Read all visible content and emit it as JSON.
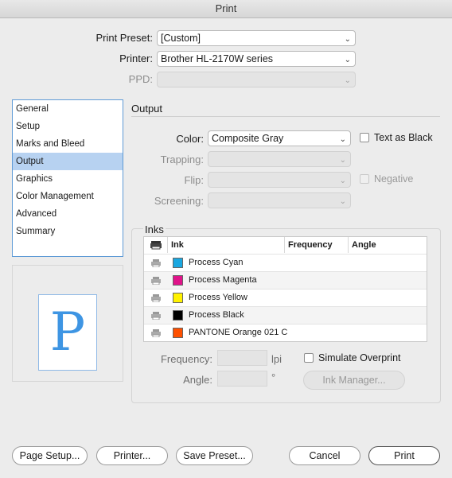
{
  "window": {
    "title": "Print"
  },
  "top": {
    "preset_label": "Print Preset:",
    "preset_value": "[Custom]",
    "printer_label": "Printer:",
    "printer_value": "Brother HL-2170W series",
    "ppd_label": "PPD:",
    "ppd_value": ""
  },
  "sidebar": {
    "items": [
      {
        "label": "General",
        "selected": false
      },
      {
        "label": "Setup",
        "selected": false
      },
      {
        "label": "Marks and Bleed",
        "selected": false
      },
      {
        "label": "Output",
        "selected": true
      },
      {
        "label": "Graphics",
        "selected": false
      },
      {
        "label": "Color Management",
        "selected": false
      },
      {
        "label": "Advanced",
        "selected": false
      },
      {
        "label": "Summary",
        "selected": false
      }
    ]
  },
  "preview": {
    "glyph": "P"
  },
  "output": {
    "section_title": "Output",
    "color_label": "Color:",
    "color_value": "Composite Gray",
    "text_as_black_label": "Text as Black",
    "trapping_label": "Trapping:",
    "trapping_value": "",
    "flip_label": "Flip:",
    "flip_value": "",
    "negative_label": "Negative",
    "screening_label": "Screening:",
    "screening_value": ""
  },
  "inks": {
    "section_title": "Inks",
    "columns": [
      "Ink",
      "Frequency",
      "Angle"
    ],
    "rows": [
      {
        "name": "Process Cyan",
        "color": "#1aa7e0"
      },
      {
        "name": "Process Magenta",
        "color": "#e0138a"
      },
      {
        "name": "Process Yellow",
        "color": "#fff200"
      },
      {
        "name": "Process Black",
        "color": "#000000"
      },
      {
        "name": "PANTONE Orange 021 C",
        "color": "#fe5000"
      }
    ],
    "frequency_label": "Frequency:",
    "frequency_unit": "lpi",
    "angle_label": "Angle:",
    "angle_unit": "°",
    "simulate_overprint_label": "Simulate Overprint",
    "ink_manager_label": "Ink Manager..."
  },
  "buttons": {
    "page_setup": "Page Setup...",
    "printer": "Printer...",
    "save_preset": "Save Preset...",
    "cancel": "Cancel",
    "print": "Print"
  }
}
